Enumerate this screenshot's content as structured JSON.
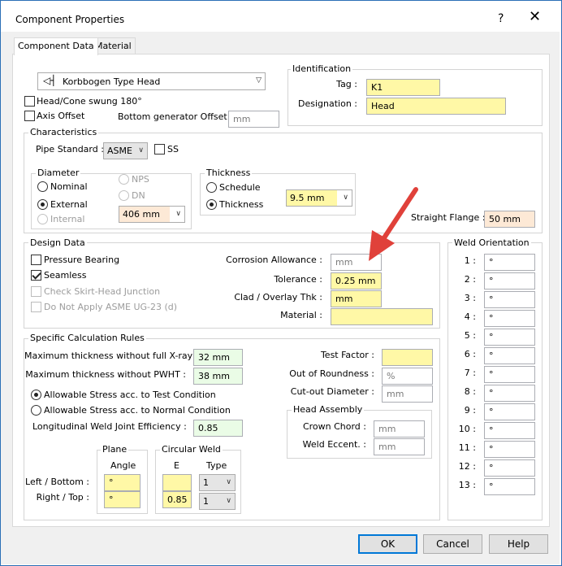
{
  "window": {
    "title": "Component Properties",
    "help": "?",
    "close": "✕"
  },
  "tabs": {
    "component_data": "Component Data",
    "material": "Material"
  },
  "component_type": "Korbbogen Type Head",
  "head_cone_swung": "Head/Cone swung 180°",
  "axis_offset": "Axis Offset",
  "bottom_generator_offset": {
    "label": "Bottom generator Offset :",
    "placeholder": "mm"
  },
  "identification": {
    "legend": "Identification",
    "tag_label": "Tag :",
    "tag_value": "K1",
    "designation_label": "Designation :",
    "designation_value": "Head"
  },
  "characteristics": {
    "legend": "Characteristics",
    "pipe_standard_label": "Pipe Standard :",
    "pipe_standard_value": "ASME",
    "ss_label": "SS",
    "diameter": {
      "legend": "Diameter",
      "nominal": "Nominal",
      "external": "External",
      "internal": "Internal",
      "nps": "NPS",
      "dn": "DN",
      "value": "406 mm"
    },
    "thickness": {
      "legend": "Thickness",
      "schedule": "Schedule",
      "thickness": "Thickness",
      "value": "9.5 mm"
    },
    "straight_flange_label": "Straight Flange :",
    "straight_flange_value": "50 mm"
  },
  "design_data": {
    "legend": "Design Data",
    "pressure_bearing": "Pressure Bearing",
    "seamless": "Seamless",
    "check_skirt": "Check Skirt-Head Junction",
    "do_not_apply": "Do Not Apply ASME UG-23 (d)",
    "corrosion_label": "Corrosion Allowance :",
    "corrosion_placeholder": "mm",
    "tolerance_label": "Tolerance :",
    "tolerance_value": "0.25 mm",
    "clad_label": "Clad / Overlay Thk :",
    "clad_value": "mm",
    "material_label": "Material :",
    "material_value": ""
  },
  "weld_orientation": {
    "legend": "Weld Orientation",
    "rows": [
      {
        "n": "1 :",
        "v": "°"
      },
      {
        "n": "2 :",
        "v": "°"
      },
      {
        "n": "3 :",
        "v": "°"
      },
      {
        "n": "4 :",
        "v": "°"
      },
      {
        "n": "5 :",
        "v": "°"
      },
      {
        "n": "6 :",
        "v": "°"
      },
      {
        "n": "7 :",
        "v": "°"
      },
      {
        "n": "8 :",
        "v": "°"
      },
      {
        "n": "9 :",
        "v": "°"
      },
      {
        "n": "10 :",
        "v": "°"
      },
      {
        "n": "11 :",
        "v": "°"
      },
      {
        "n": "12 :",
        "v": "°"
      },
      {
        "n": "13 :",
        "v": "°"
      }
    ]
  },
  "calc_rules": {
    "legend": "Specific Calculation Rules",
    "max_xray_label": "Maximum thickness without full X-ray :",
    "max_xray_value": "32 mm",
    "max_pwht_label": "Maximum thickness without PWHT :",
    "max_pwht_value": "38 mm",
    "stress_test": "Allowable Stress acc. to Test Condition",
    "stress_normal": "Allowable Stress acc. to Normal Condition",
    "weld_eff_label": "Longitudinal Weld Joint Efficiency :",
    "weld_eff_value": "0.85",
    "test_factor_label": "Test Factor :",
    "test_factor_value": "",
    "out_of_round_label": "Out of Roundness :",
    "out_of_round_placeholder": "%",
    "cutout_label": "Cut-out Diameter :",
    "cutout_placeholder": "mm",
    "head_assembly": {
      "legend": "Head Assembly",
      "crown_label": "Crown Chord :",
      "crown_placeholder": "mm",
      "weld_eccent_label": "Weld Eccent. :",
      "weld_eccent_placeholder": "mm"
    },
    "plane": {
      "legend": "Plane",
      "angle_header": "Angle",
      "left_bottom_label": "Left / Bottom :",
      "left_bottom_value": "°",
      "right_top_label": "Right / Top :",
      "right_top_value": "°"
    },
    "circular_weld": {
      "legend": "Circular Weld",
      "e_header": "E",
      "type_header": "Type",
      "e1_value": "",
      "type1_value": "1",
      "e2_value": "0.85",
      "type2_value": "1"
    }
  },
  "buttons": {
    "ok": "OK",
    "cancel": "Cancel",
    "help": "Help"
  },
  "colors": {
    "arrow": "#e0413a",
    "required_field": "#fff8a6",
    "accent": "#0078d7"
  }
}
